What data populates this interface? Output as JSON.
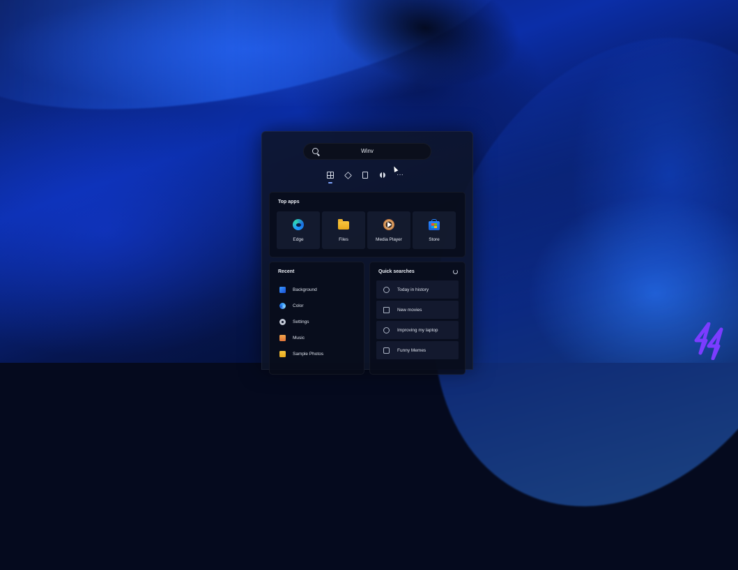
{
  "search": {
    "query": "Winv"
  },
  "tabs": [
    "all-apps",
    "layers",
    "documents",
    "web",
    "more"
  ],
  "top_apps": {
    "title": "Top apps",
    "apps": [
      {
        "label": "Edge",
        "icon": "edge-icon"
      },
      {
        "label": "Files",
        "icon": "folder-icon"
      },
      {
        "label": "Media Player",
        "icon": "media-player-icon"
      },
      {
        "label": "Store",
        "icon": "store-icon"
      }
    ]
  },
  "recent": {
    "title": "Recent",
    "items": [
      {
        "label": "Background",
        "icon": "image-icon"
      },
      {
        "label": "Color",
        "icon": "color-icon"
      },
      {
        "label": "Settings",
        "icon": "gear-icon"
      },
      {
        "label": "Music",
        "icon": "music-folder-icon"
      },
      {
        "label": "Sample Photos",
        "icon": "folder-icon"
      }
    ]
  },
  "quick_searches": {
    "title": "Quick searches",
    "items": [
      {
        "label": "Today in history",
        "icon": "clock-icon"
      },
      {
        "label": "New movies",
        "icon": "movie-icon"
      },
      {
        "label": "Improving my laptop",
        "icon": "laptop-icon"
      },
      {
        "label": "Funny Memes",
        "icon": "meme-icon"
      }
    ]
  },
  "colors": {
    "accent": "#7fa6ff",
    "brand_logo": "#7b3cff"
  }
}
